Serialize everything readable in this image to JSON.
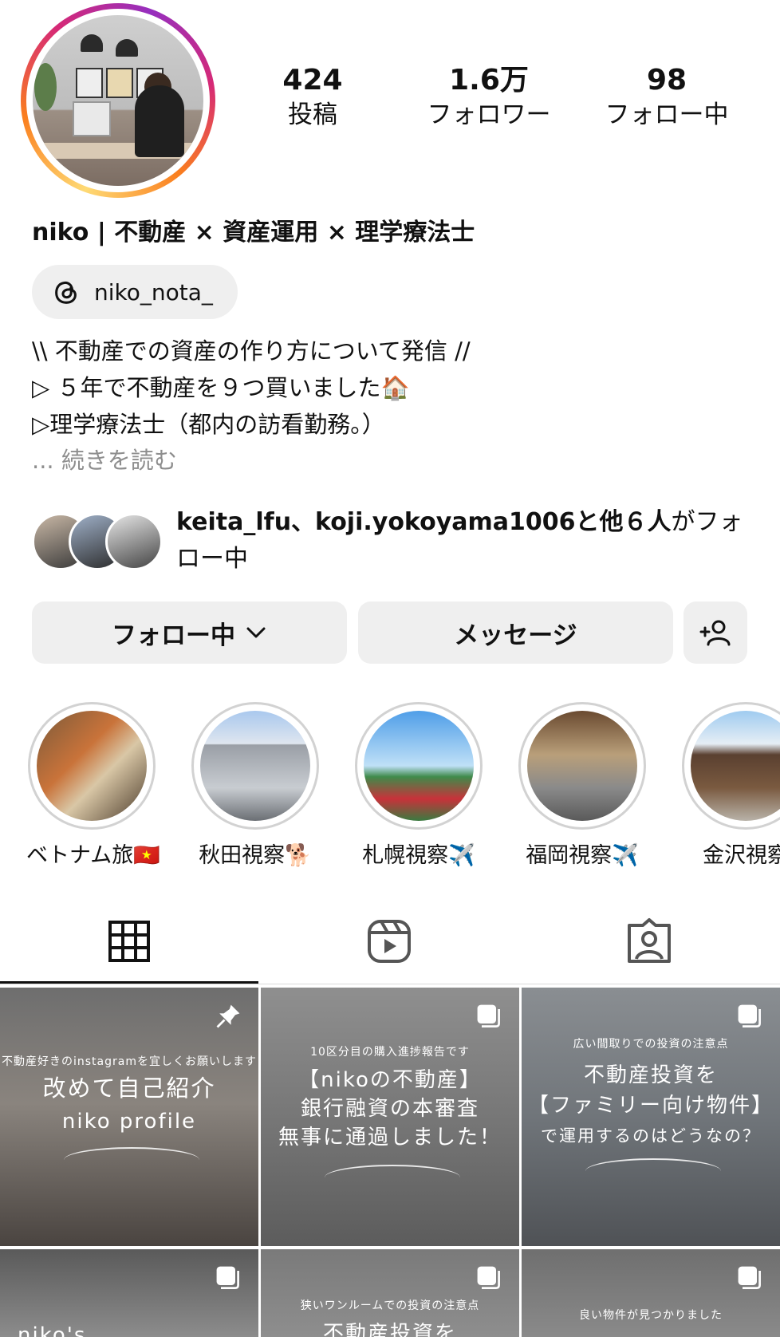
{
  "profile": {
    "stats": {
      "posts": {
        "value": "424",
        "label": "投稿"
      },
      "followers": {
        "value": "1.6万",
        "label": "フォロワー"
      },
      "following": {
        "value": "98",
        "label": "フォロー中"
      }
    },
    "display_name": "niko | 不動産 × 資産運用 × 理学療法士",
    "threads_handle": "niko_nota_",
    "bio_lines": [
      "\\\\ 不動産での資産の作り方について発信 //",
      "▷ ５年で不動産を９つ買いました🏠",
      "▷理学療法士（都内の訪看勤務。）"
    ],
    "bio_more": "... 続きを読む",
    "followed_by": {
      "names": "keita_lfu、koji.yokoyama1006",
      "rest_bold": "と他６人",
      "suffix": "がフォロー中"
    }
  },
  "actions": {
    "following_button": "フォロー中",
    "message_button": "メッセージ",
    "add_user_icon": "person-add-icon"
  },
  "highlights": [
    {
      "label": "ベトナム旅🇻🇳"
    },
    {
      "label": "秋田視察🐕"
    },
    {
      "label": "札幌視察✈️"
    },
    {
      "label": "福岡視察✈️"
    },
    {
      "label": "金沢視察"
    }
  ],
  "tabs": [
    "grid-icon",
    "reels-icon",
    "tagged-icon"
  ],
  "posts": [
    {
      "subtitle": "不動産好きのinstagramを宜しくお願いします",
      "title_lines": [
        "改めて自己紹介",
        "niko profile"
      ],
      "corner": "pin-icon"
    },
    {
      "subtitle": "10区分目の購入進捗報告です",
      "title_lines": [
        "【nikoの不動産】",
        "銀行融資の本審査",
        "無事に通過しました！"
      ],
      "corner": "carousel-icon"
    },
    {
      "subtitle": "広い間取りでの投資の注意点",
      "title_lines": [
        "不動産投資を",
        "【ファミリー向け物件】",
        "で運用するのはどうなの？"
      ],
      "corner": "carousel-icon"
    },
    {
      "subtitle": "",
      "title_lines": [
        "niko's"
      ],
      "corner": "carousel-icon"
    },
    {
      "subtitle": "狭いワンルームでの投資の注意点",
      "title_lines": [
        "不動産投資を"
      ],
      "corner": "carousel-icon"
    },
    {
      "subtitle": "良い物件が見つかりました",
      "title_lines": [
        ""
      ],
      "corner": "carousel-icon"
    }
  ],
  "colors": {
    "button_bg": "#efefef",
    "muted": "#8e8e8e",
    "text": "#111111"
  }
}
